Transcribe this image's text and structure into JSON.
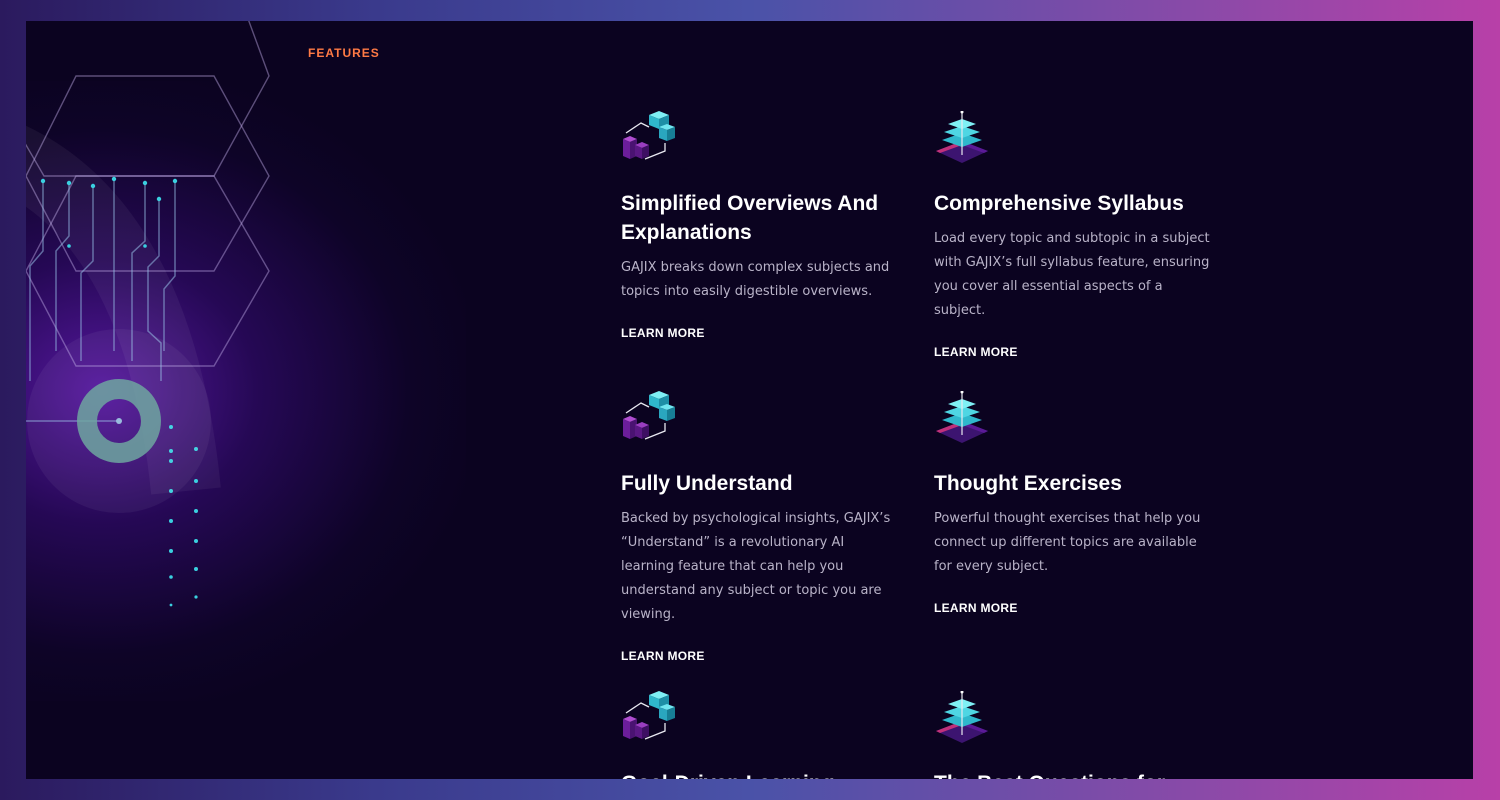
{
  "section": {
    "eyebrow": "FEATURES"
  },
  "features": [
    {
      "title": "Simplified Overviews And Explanations",
      "description": "GAJIX breaks down complex subjects and topics into easily digestible overviews.",
      "link": "LEARN MORE",
      "icon": "cubes-icon"
    },
    {
      "title": "Comprehensive Syllabus",
      "description": "Load every topic and subtopic in a subject with GAJIX’s full syllabus feature, ensuring you cover all essential aspects of a subject.",
      "link": "LEARN MORE",
      "icon": "layers-stack-icon"
    },
    {
      "title": "Fully Understand",
      "description": "Backed by psychological insights, GAJIX’s “Understand” is a revolutionary AI learning feature that can help you understand any subject or topic you are viewing.",
      "link": "LEARN MORE",
      "icon": "cubes-icon"
    },
    {
      "title": "Thought Exercises",
      "description": "Powerful thought exercises that help you connect up different topics are available for every subject.",
      "link": "LEARN MORE",
      "icon": "layers-stack-icon"
    },
    {
      "title": "Goal-Driven Learning",
      "icon": "cubes-icon"
    },
    {
      "title": "The Best Questions for",
      "icon": "layers-stack-icon"
    }
  ],
  "colors": {
    "background": "#0b0320",
    "accent": "#ff7a45",
    "cyan": "#38d6e0",
    "purple": "#7a2bb0"
  }
}
